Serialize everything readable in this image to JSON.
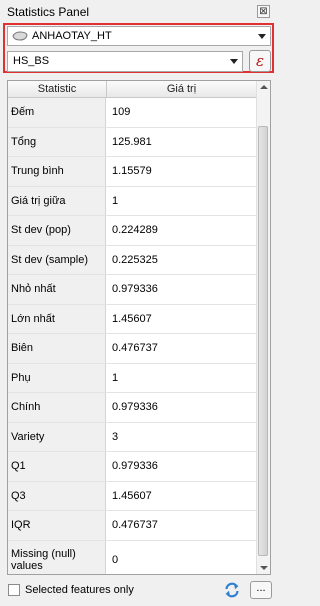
{
  "panel": {
    "title": "Statistics Panel",
    "close_glyph": "⊠"
  },
  "layer_select": {
    "value": "ANHAOTAY_HT",
    "icon": "polygon-layer-icon"
  },
  "field_select": {
    "value": "HS_BS"
  },
  "expression_button": {
    "glyph": "ε",
    "icon": "expression-icon"
  },
  "table": {
    "headers": [
      "Statistic",
      "Giá trị"
    ],
    "rows": [
      {
        "stat": "Đếm",
        "value": "109"
      },
      {
        "stat": "Tổng",
        "value": "125.981"
      },
      {
        "stat": "Trung bình",
        "value": "1.15579"
      },
      {
        "stat": "Giá trị giữa",
        "value": "1"
      },
      {
        "stat": "St dev (pop)",
        "value": "0.224289"
      },
      {
        "stat": "St dev (sample)",
        "value": "0.225325"
      },
      {
        "stat": "Nhỏ nhất",
        "value": "0.979336"
      },
      {
        "stat": "Lớn nhất",
        "value": "1.45607"
      },
      {
        "stat": "Biên",
        "value": "0.476737"
      },
      {
        "stat": "Phụ",
        "value": "1"
      },
      {
        "stat": "Chính",
        "value": "0.979336"
      },
      {
        "stat": "Variety",
        "value": "3"
      },
      {
        "stat": "Q1",
        "value": "0.979336"
      },
      {
        "stat": "Q3",
        "value": "1.45607"
      },
      {
        "stat": "IQR",
        "value": "0.476737"
      },
      {
        "stat": "Missing (null) values",
        "value": "0"
      }
    ]
  },
  "footer": {
    "selected_only_label": "Selected features only",
    "selected_only_checked": false,
    "more_label": "..."
  },
  "colors": {
    "highlight": "#e03030",
    "expression": "#b01818",
    "refresh": "#2f7fd0"
  }
}
